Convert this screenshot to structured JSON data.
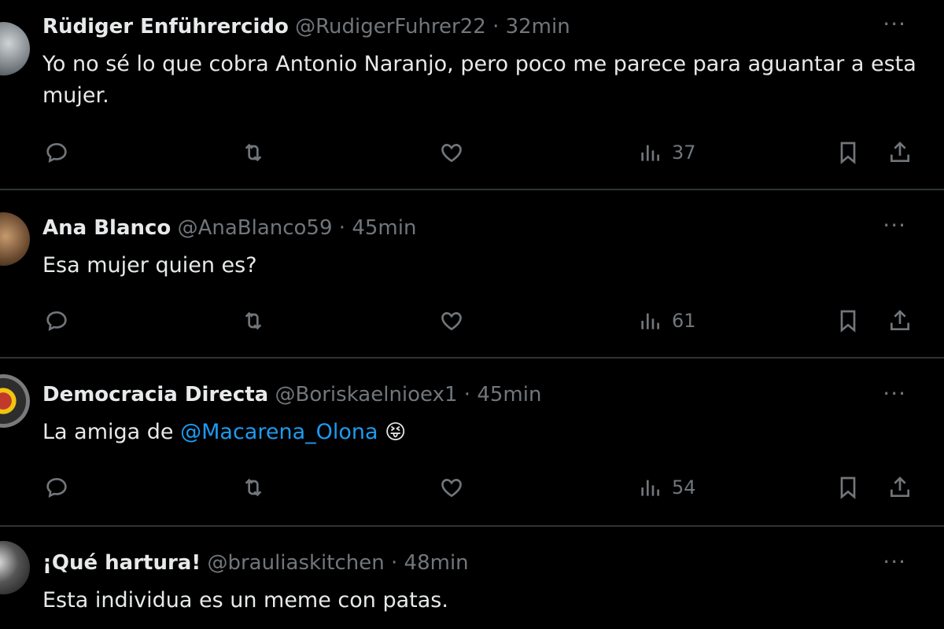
{
  "tweets": [
    {
      "name": "Rüdiger Enführercido",
      "handle": "@RudigerFuhrer22",
      "separator": "·",
      "time": "32min",
      "text": "Yo no sé lo que cobra Antonio Naranjo, pero poco me parece para aguantar a esta mujer.",
      "views": "37"
    },
    {
      "name": "Ana Blanco",
      "handle": "@AnaBlanco59",
      "separator": "·",
      "time": "45min",
      "text": "Esa mujer quien es?",
      "views": "61"
    },
    {
      "name": "Democracia Directa",
      "handle": "@Boriskaelnioex1",
      "separator": "·",
      "time": "45min",
      "text_before": "La amiga de ",
      "mention": "@Macarena_Olona",
      "emoji": "😝",
      "views": "54"
    },
    {
      "name": "¡Qué hartura!",
      "handle": "@brauliaskitchen",
      "separator": "·",
      "time": "48min",
      "text": "Esta individua es un meme con patas."
    }
  ],
  "more_label": "···",
  "icons": {
    "reply": "reply-icon",
    "retweet": "retweet-icon",
    "like": "heart-icon",
    "views": "views-icon",
    "bookmark": "bookmark-icon",
    "share": "share-icon"
  },
  "colors": {
    "background": "#000000",
    "text": "#e7e9ea",
    "muted": "#71767b",
    "link": "#1d9bf0",
    "divider": "#2f3336"
  }
}
